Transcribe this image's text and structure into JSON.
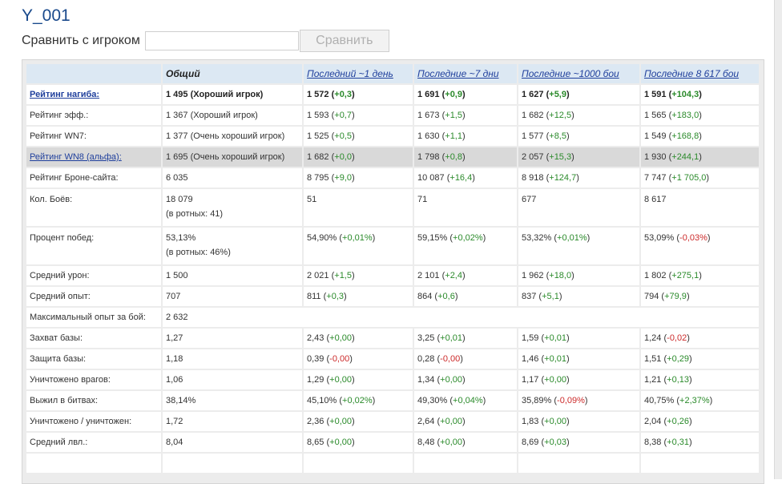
{
  "player_name": "Y_001",
  "compare": {
    "label": "Сравнить с игроком",
    "input_value": "",
    "button_label": "Сравнить"
  },
  "columns": {
    "label_col": "",
    "overall": "Общий",
    "day": "Последний ~1 день",
    "week": "Последние ~7 дни",
    "k1000": "Последние ~1000 бои",
    "all": "Последние 8 617 бои"
  },
  "rows": [
    {
      "label": "Рейтинг нагиба:",
      "link": true,
      "bold": true,
      "overall": "1 495 (Хороший игрок)",
      "overall_sub": "",
      "day": "1 572",
      "day_d": "+0,3",
      "day_s": "pos",
      "week": "1 691",
      "week_d": "+0,9",
      "week_s": "pos",
      "k1000": "1 627",
      "k1000_d": "+5,9",
      "k1000_s": "pos",
      "all": "1 591",
      "all_d": "+104,3",
      "all_s": "pos"
    },
    {
      "label": "Рейтинг эфф.:",
      "overall": "1 367 (Хороший игрок)",
      "overall_sub": "",
      "day": "1 593",
      "day_d": "+0,7",
      "day_s": "pos",
      "week": "1 673",
      "week_d": "+1,5",
      "week_s": "pos",
      "k1000": "1 682",
      "k1000_d": "+12,5",
      "k1000_s": "pos",
      "all": "1 565",
      "all_d": "+183,0",
      "all_s": "pos"
    },
    {
      "label": "Рейтинг WN7:",
      "overall": "1 377 (Очень хороший игрок)",
      "overall_sub": "",
      "day": "1 525",
      "day_d": "+0,5",
      "day_s": "pos",
      "week": "1 630",
      "week_d": "+1,1",
      "week_s": "pos",
      "k1000": "1 577",
      "k1000_d": "+8,5",
      "k1000_s": "pos",
      "all": "1 549",
      "all_d": "+168,8",
      "all_s": "pos"
    },
    {
      "label": "Рейтинг WN8 (альфа):",
      "link": true,
      "highlight": true,
      "overall": "1 695 (Очень хороший игрок)",
      "overall_sub": "",
      "day": "1 682",
      "day_d": "+0,0",
      "day_s": "pos",
      "week": "1 798",
      "week_d": "+0,8",
      "week_s": "pos",
      "k1000": "2 057",
      "k1000_d": "+15,3",
      "k1000_s": "pos",
      "all": "1 930",
      "all_d": "+244,1",
      "all_s": "pos"
    },
    {
      "label": "Рейтинг Броне-сайта:",
      "overall": "6 035",
      "overall_sub": "",
      "day": "8 795",
      "day_d": "+9,0",
      "day_s": "pos",
      "week": "10 087",
      "week_d": "+16,4",
      "week_s": "pos",
      "k1000": "8 918",
      "k1000_d": "+124,7",
      "k1000_s": "pos",
      "all": "7 747",
      "all_d": "+1 705,0",
      "all_s": "pos"
    },
    {
      "label": "Кол. Боёв:",
      "tall": true,
      "overall": "18 079",
      "overall_sub": "(в ротных: 41)",
      "day": "51",
      "day_d": "",
      "day_s": "",
      "week": "71",
      "week_d": "",
      "week_s": "",
      "k1000": "677",
      "k1000_d": "",
      "k1000_s": "",
      "all": "8 617",
      "all_d": "",
      "all_s": ""
    },
    {
      "label": "Процент побед:",
      "tall": true,
      "overall": "53,13%",
      "overall_sub": "(в ротных: 46%)",
      "day": "54,90%",
      "day_d": "+0,01%",
      "day_s": "pos",
      "week": "59,15%",
      "week_d": "+0,02%",
      "week_s": "pos",
      "k1000": "53,32%",
      "k1000_d": "+0,01%",
      "k1000_s": "pos",
      "all": "53,09%",
      "all_d": "-0,03%",
      "all_s": "neg"
    },
    {
      "label": "Средний урон:",
      "overall": "1 500",
      "overall_sub": "",
      "day": "2 021",
      "day_d": "+1,5",
      "day_s": "pos",
      "week": "2 101",
      "week_d": "+2,4",
      "week_s": "pos",
      "k1000": "1 962",
      "k1000_d": "+18,0",
      "k1000_s": "pos",
      "all": "1 802",
      "all_d": "+275,1",
      "all_s": "pos"
    },
    {
      "label": "Средний опыт:",
      "overall": "707",
      "overall_sub": "",
      "day": "811",
      "day_d": "+0,3",
      "day_s": "pos",
      "week": "864",
      "week_d": "+0,6",
      "week_s": "pos",
      "k1000": "837",
      "k1000_d": "+5,1",
      "k1000_s": "pos",
      "all": "794",
      "all_d": "+79,9",
      "all_s": "pos"
    },
    {
      "label": "Максимальный опыт за бой:",
      "span": true,
      "overall": "2 632",
      "overall_sub": ""
    },
    {
      "label": "Захват базы:",
      "overall": "1,27",
      "overall_sub": "",
      "day": "2,43",
      "day_d": "+0,00",
      "day_s": "pos",
      "week": "3,25",
      "week_d": "+0,01",
      "week_s": "pos",
      "k1000": "1,59",
      "k1000_d": "+0,01",
      "k1000_s": "pos",
      "all": "1,24",
      "all_d": "-0,02",
      "all_s": "neg"
    },
    {
      "label": "Защита базы:",
      "overall": "1,18",
      "overall_sub": "",
      "day": "0,39",
      "day_d": "-0,00",
      "day_s": "neg",
      "week": "0,28",
      "week_d": "-0,00",
      "week_s": "neg",
      "k1000": "1,46",
      "k1000_d": "+0,01",
      "k1000_s": "pos",
      "all": "1,51",
      "all_d": "+0,29",
      "all_s": "pos"
    },
    {
      "label": "Уничтожено врагов:",
      "overall": "1,06",
      "overall_sub": "",
      "day": "1,29",
      "day_d": "+0,00",
      "day_s": "pos",
      "week": "1,34",
      "week_d": "+0,00",
      "week_s": "pos",
      "k1000": "1,17",
      "k1000_d": "+0,00",
      "k1000_s": "pos",
      "all": "1,21",
      "all_d": "+0,13",
      "all_s": "pos"
    },
    {
      "label": "Выжил в битвах:",
      "overall": "38,14%",
      "overall_sub": "",
      "day": "45,10%",
      "day_d": "+0,02%",
      "day_s": "pos",
      "week": "49,30%",
      "week_d": "+0,04%",
      "week_s": "pos",
      "k1000": "35,89%",
      "k1000_d": "-0,09%",
      "k1000_s": "neg",
      "all": "40,75%",
      "all_d": "+2,37%",
      "all_s": "pos"
    },
    {
      "label": "Уничтожено / уничтожен:",
      "overall": "1,72",
      "overall_sub": "",
      "day": "2,36",
      "day_d": "+0,00",
      "day_s": "pos",
      "week": "2,64",
      "week_d": "+0,00",
      "week_s": "pos",
      "k1000": "1,83",
      "k1000_d": "+0,00",
      "k1000_s": "pos",
      "all": "2,04",
      "all_d": "+0,26",
      "all_s": "pos"
    },
    {
      "label": "Средний лвл.:",
      "overall": "8,04",
      "overall_sub": "",
      "day": "8,65",
      "day_d": "+0,00",
      "day_s": "pos",
      "week": "8,48",
      "week_d": "+0,00",
      "week_s": "pos",
      "k1000": "8,69",
      "k1000_d": "+0,03",
      "k1000_s": "pos",
      "all": "8,38",
      "all_d": "+0,31",
      "all_s": "pos"
    }
  ],
  "colors": {
    "positive": "#2a8a2a",
    "negative": "#cc2a2a",
    "link": "#1f3f9c",
    "header_bg": "#dce8f3",
    "highlight_row": "#d9d9d9"
  }
}
